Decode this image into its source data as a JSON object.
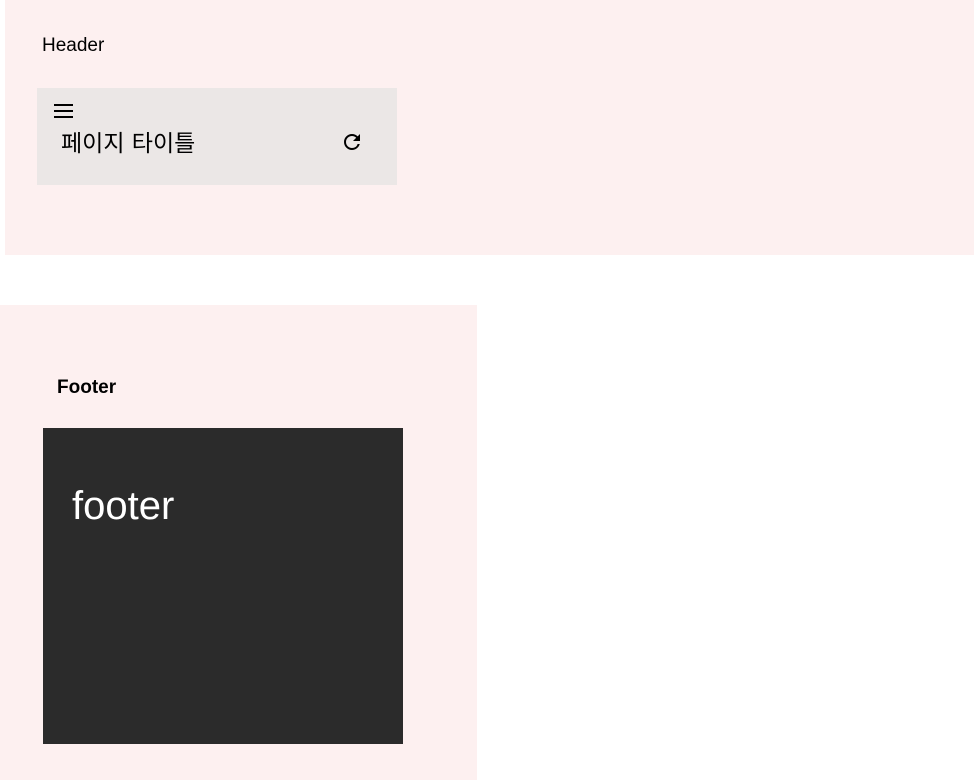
{
  "header": {
    "label": "Header",
    "appbar": {
      "menu_icon": "menu-icon",
      "title": "페이지 타이틀",
      "refresh_icon": "refresh-icon"
    }
  },
  "footer": {
    "label": "Footer",
    "content_text": "footer"
  },
  "colors": {
    "panel_background": "#fdf0f0",
    "appbar_background": "#ebe7e6",
    "footer_box_background": "#2b2b2b",
    "footer_text": "#ffffff"
  }
}
